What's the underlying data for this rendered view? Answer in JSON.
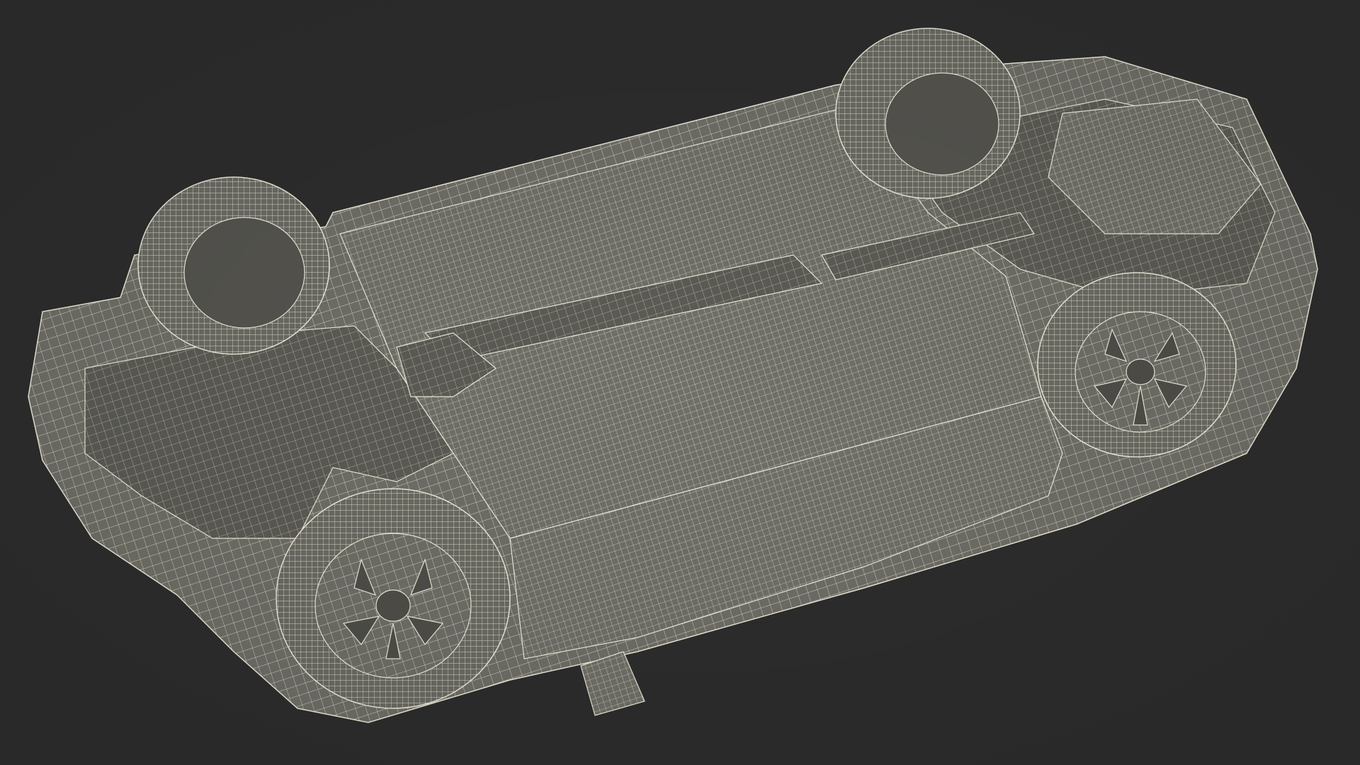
{
  "scene": {
    "background_color": "#2d2d2d",
    "model_color": "#6f6e67",
    "wire_color": "#ece9d8",
    "subject": "car-underside-wireframe",
    "parts": [
      "body-shell",
      "front-left-wheel",
      "front-right-wheel",
      "rear-left-wheel",
      "rear-right-wheel",
      "exhaust-system",
      "fuel-tank",
      "front-subframe",
      "rear-subframe",
      "floor-pan",
      "rocker-panel"
    ]
  }
}
